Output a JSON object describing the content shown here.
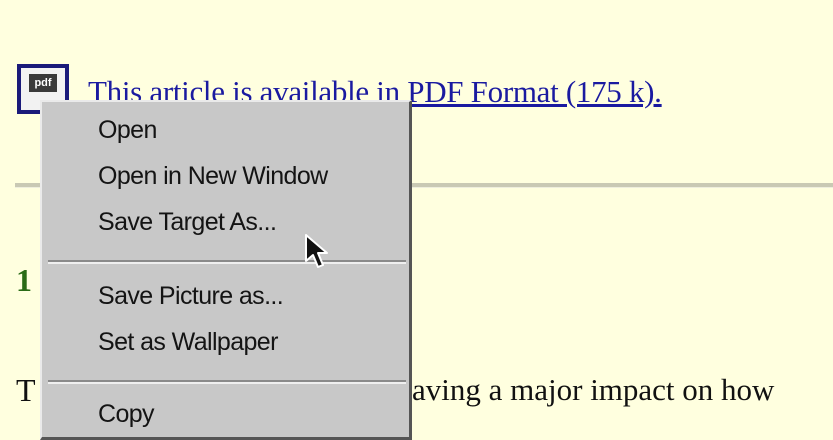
{
  "page": {
    "pdf_icon_label": "pdf",
    "pdf_link_text": "This article is available in PDF Format (175 k).",
    "heading_fragment": "1",
    "paragraph_first_letter": "T",
    "paragraph_fragment": "aving a major impact on how"
  },
  "context_menu": {
    "items": [
      "Open",
      "Open in New Window",
      "Save Target As...",
      "Save Picture as...",
      "Set as Wallpaper",
      "Copy"
    ]
  },
  "colors": {
    "page_background": "#ffffdf",
    "link": "#1a1aa0",
    "heading": "#2a6b16",
    "menu_background": "#c8c8c8"
  }
}
